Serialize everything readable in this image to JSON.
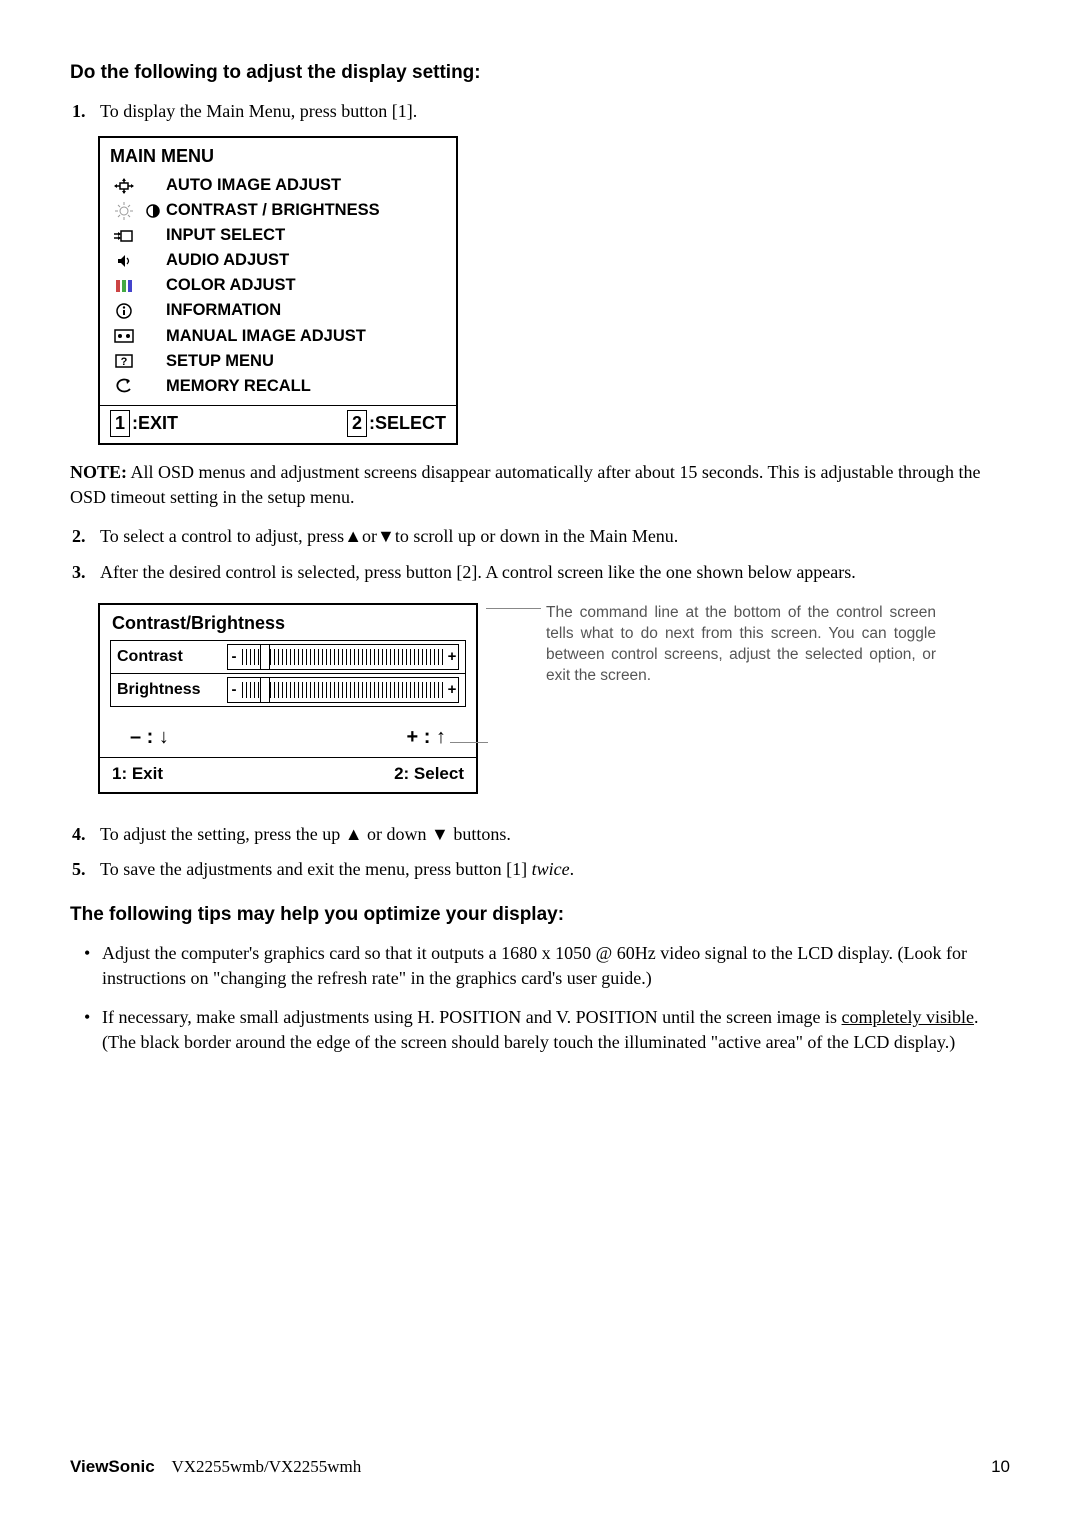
{
  "heading1": "Do the following to adjust the display setting:",
  "step1": {
    "num": "1.",
    "text_a": "To display the Main Menu, press button [1]."
  },
  "mainMenu": {
    "title": "MAIN MENU",
    "items": [
      "AUTO IMAGE ADJUST",
      "CONTRAST / BRIGHTNESS",
      "INPUT SELECT",
      "AUDIO ADJUST",
      "COLOR ADJUST",
      "INFORMATION",
      "MANUAL IMAGE ADJUST",
      "SETUP MENU",
      "MEMORY RECALL"
    ],
    "footer": {
      "exitKey": "1",
      "exitLabel": ":EXIT",
      "selectKey": "2",
      "selectLabel": ":SELECT"
    }
  },
  "note": {
    "label": "NOTE:",
    "text": " All OSD menus and adjustment screens disappear automatically after about 15 seconds. This is adjustable through the OSD timeout setting in the setup menu."
  },
  "step2": {
    "num": "2.",
    "pre": "To select a control to adjust, press",
    "mid": "or",
    "post": "to scroll up or down in the Main Menu."
  },
  "step3": {
    "num": "3.",
    "text": "After the desired control is selected, press button [2]. A control screen like the one shown below appears."
  },
  "cb": {
    "title": "Contrast/Brightness",
    "row1": "Contrast",
    "row2": "Brightness",
    "arrowMinus": "– : ",
    "arrowPlus": "+ : ",
    "footerLeft": "1: Exit",
    "footerRight": "2: Select"
  },
  "caption": "The command line at the bottom of the control screen tells what to do next from this screen. You can toggle between control screens, adjust the selected option, or exit the screen.",
  "step4": {
    "num": "4.",
    "pre": "To adjust the setting, press the up ",
    "mid": " or down ",
    "post": " buttons."
  },
  "step5": {
    "num": "5.",
    "pre": "To save the adjustments and exit the menu, press button [1] ",
    "italic": "twice",
    "post": "."
  },
  "heading2": "The following tips may help you optimize your display:",
  "tip1": "Adjust the computer's graphics card so that it outputs a 1680 x 1050 @ 60Hz video signal to the LCD display. (Look for instructions on \"changing the refresh rate\" in the graphics card's user guide.)",
  "tip2_pre": "If necessary, make small adjustments using H. POSITION and V. POSITION until the screen image is ",
  "tip2_underline": "completely visible",
  "tip2_post": ". (The black border around the edge of the screen should barely touch the illuminated \"active area\" of the LCD display.)",
  "footer": {
    "brand": "ViewSonic",
    "model": "VX2255wmb/VX2255wmh",
    "page": "10"
  }
}
